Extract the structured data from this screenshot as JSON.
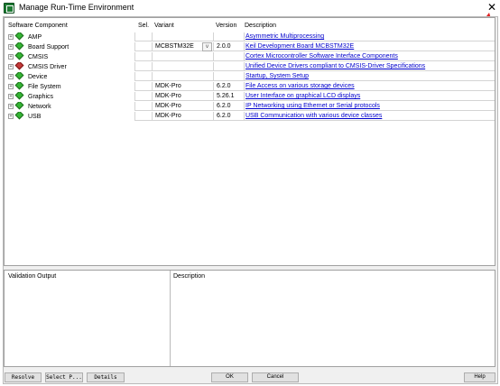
{
  "window": {
    "title": "Manage Run-Time Environment",
    "close_glyph": "✕"
  },
  "table": {
    "headers": {
      "component": "Software Component",
      "sel": "Sel.",
      "variant": "Variant",
      "version": "Version",
      "description": "Description"
    },
    "rows": [
      {
        "name": "AMP",
        "icon": "green-diamond-icon",
        "sel": "",
        "variant": "",
        "version": "",
        "description": "Asymmetric Multiprocessing"
      },
      {
        "name": "Board Support",
        "icon": "green-diamond-icon",
        "sel": "",
        "variant": "MCBSTM32E",
        "version": "2.0.0",
        "description": "Keil Development Board MCBSTM32E"
      },
      {
        "name": "CMSIS",
        "icon": "green-diamond-icon",
        "sel": "",
        "variant": "",
        "version": "",
        "description": "Cortex Microcontroller Software Interface Components"
      },
      {
        "name": "CMSIS Driver",
        "icon": "red-diamond-icon",
        "sel": "",
        "variant": "",
        "version": "",
        "description": "Unified Device Drivers compliant to CMSIS-Driver Specifications"
      },
      {
        "name": "Device",
        "icon": "green-diamond-icon",
        "sel": "",
        "variant": "",
        "version": "",
        "description": "Startup, System Setup"
      },
      {
        "name": "File System",
        "icon": "green-diamond-icon",
        "sel": "",
        "variant": "MDK-Pro",
        "version": "6.2.0",
        "description": "File Access on various storage devices"
      },
      {
        "name": "Graphics",
        "icon": "green-diamond-icon",
        "sel": "",
        "variant": "MDK-Pro",
        "version": "5.26.1",
        "description": "User Interface on graphical LCD displays"
      },
      {
        "name": "Network",
        "icon": "green-diamond-icon",
        "sel": "",
        "variant": "MDK-Pro",
        "version": "6.2.0",
        "description": "IP Networking using Ethernet or Serial protocols"
      },
      {
        "name": "USB",
        "icon": "green-diamond-icon",
        "sel": "",
        "variant": "MDK-Pro",
        "version": "6.2.0",
        "description": "USB Communication with various device classes"
      }
    ]
  },
  "validation": {
    "output_label": "Validation Output",
    "description_label": "Description"
  },
  "buttons": {
    "resolve": "Resolve",
    "select_packs": "Select P...",
    "details": "Details",
    "ok": "OK",
    "cancel": "Cancel",
    "help": "Help"
  },
  "colors": {
    "link": "#0000cc",
    "annotation_arrow": "#e02020",
    "ok_diamond": "#34b534",
    "error_diamond": "#c43a3a"
  }
}
